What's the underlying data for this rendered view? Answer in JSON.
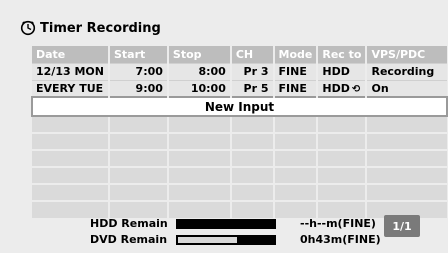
{
  "title": "Timer Recording",
  "columns": [
    "Date",
    "Start",
    "Stop",
    "CH",
    "Mode",
    "Rec to",
    "VPS/PDC"
  ],
  "rows": [
    {
      "date": "12/13 MON",
      "start": "7:00",
      "stop": "8:00",
      "ch": "Pr 3",
      "mode": "FINE",
      "rec_to": "HDD",
      "rec_to_icon": "",
      "vps": "Recording"
    },
    {
      "date": "EVERY TUE",
      "start": "9:00",
      "stop": "10:00",
      "ch": "Pr 5",
      "mode": "FINE",
      "rec_to": "HDD",
      "rec_to_icon": "repeat-icon",
      "vps": "On"
    }
  ],
  "new_input_label": "New Input",
  "footer": {
    "hdd_label": "HDD Remain",
    "hdd_value": "--h--m(FINE)",
    "dvd_label": "DVD Remain",
    "dvd_value": "0h43m(FINE)",
    "dvd_fill_fraction": 0.6,
    "page": "1/1"
  }
}
